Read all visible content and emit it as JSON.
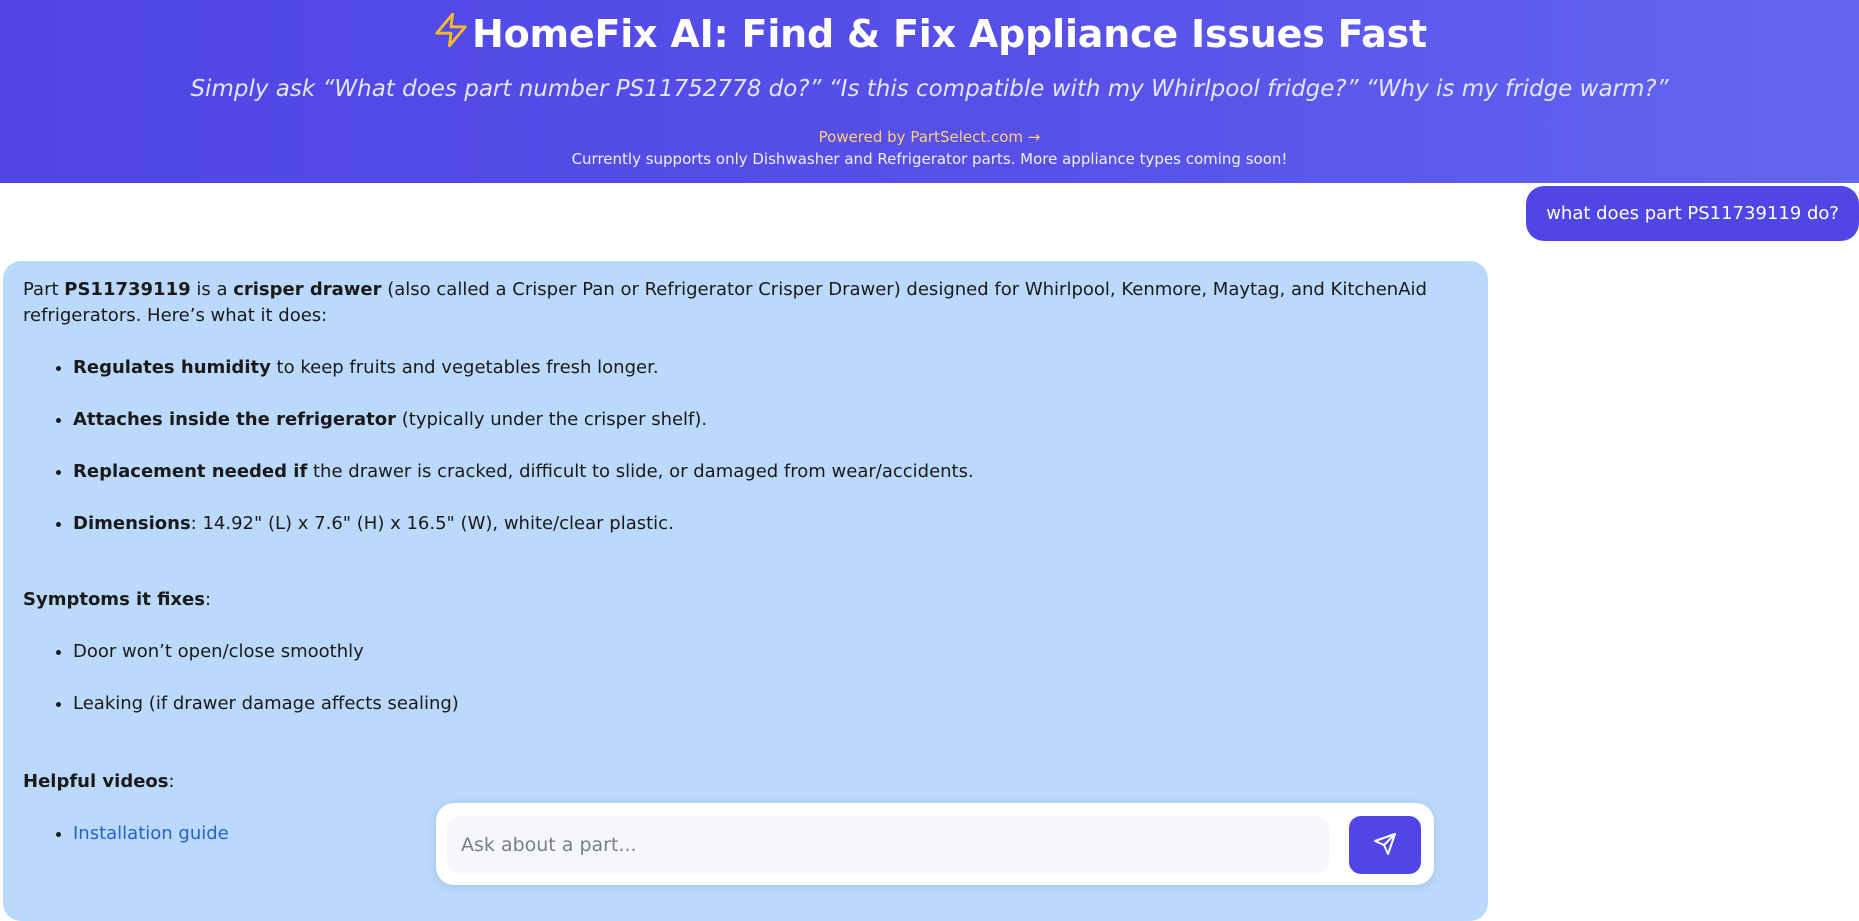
{
  "header": {
    "title": "HomeFix AI: Find & Fix Appliance Issues Fast",
    "subtitle": "Simply ask “What does part number PS11752778 do?” “Is this compatible with my Whirlpool fridge?” “Why is my fridge warm?”",
    "powered_by": "Powered by PartSelect.com →",
    "support_note": "Currently supports only Dishwasher and Refrigerator parts. More appliance types coming soon!",
    "icon": "lightning-icon",
    "accent_color": "#4f46e5",
    "icon_color": "#f5b82e"
  },
  "user_message": {
    "text": "what does part PS11739119 do?"
  },
  "bot_message": {
    "intro": {
      "t1": "Part ",
      "part": "PS11739119",
      "t2": " is a ",
      "type": "crisper drawer",
      "t3": " (also called a Crisper Pan or Refrigerator Crisper Drawer) designed for Whirlpool, Kenmore, Maytag, and KitchenAid refrigerators. Here’s what it does:"
    },
    "features": [
      {
        "bold": "Regulates humidity",
        "text": " to keep fruits and vegetables fresh longer."
      },
      {
        "bold": "Attaches inside the refrigerator",
        "text": " (typically under the crisper shelf)."
      },
      {
        "bold": "Replacement needed if",
        "text": " the drawer is cracked, difficult to slide, or damaged from wear/accidents."
      },
      {
        "bold": "Dimensions",
        "text": ": 14.92\" (L) x 7.6\" (H) x 16.5\" (W), white/clear plastic."
      }
    ],
    "symptoms_title": "Symptoms it fixes",
    "symptoms": [
      "Door won’t open/close smoothly",
      "Leaking (if drawer damage affects sealing)"
    ],
    "videos_title": "Helpful videos",
    "videos": [
      "Installation guide"
    ],
    "colon": ":",
    "bubble_color": "#bbd9fb"
  },
  "composer": {
    "placeholder": "Ask about a part...",
    "send_icon": "send-icon"
  }
}
